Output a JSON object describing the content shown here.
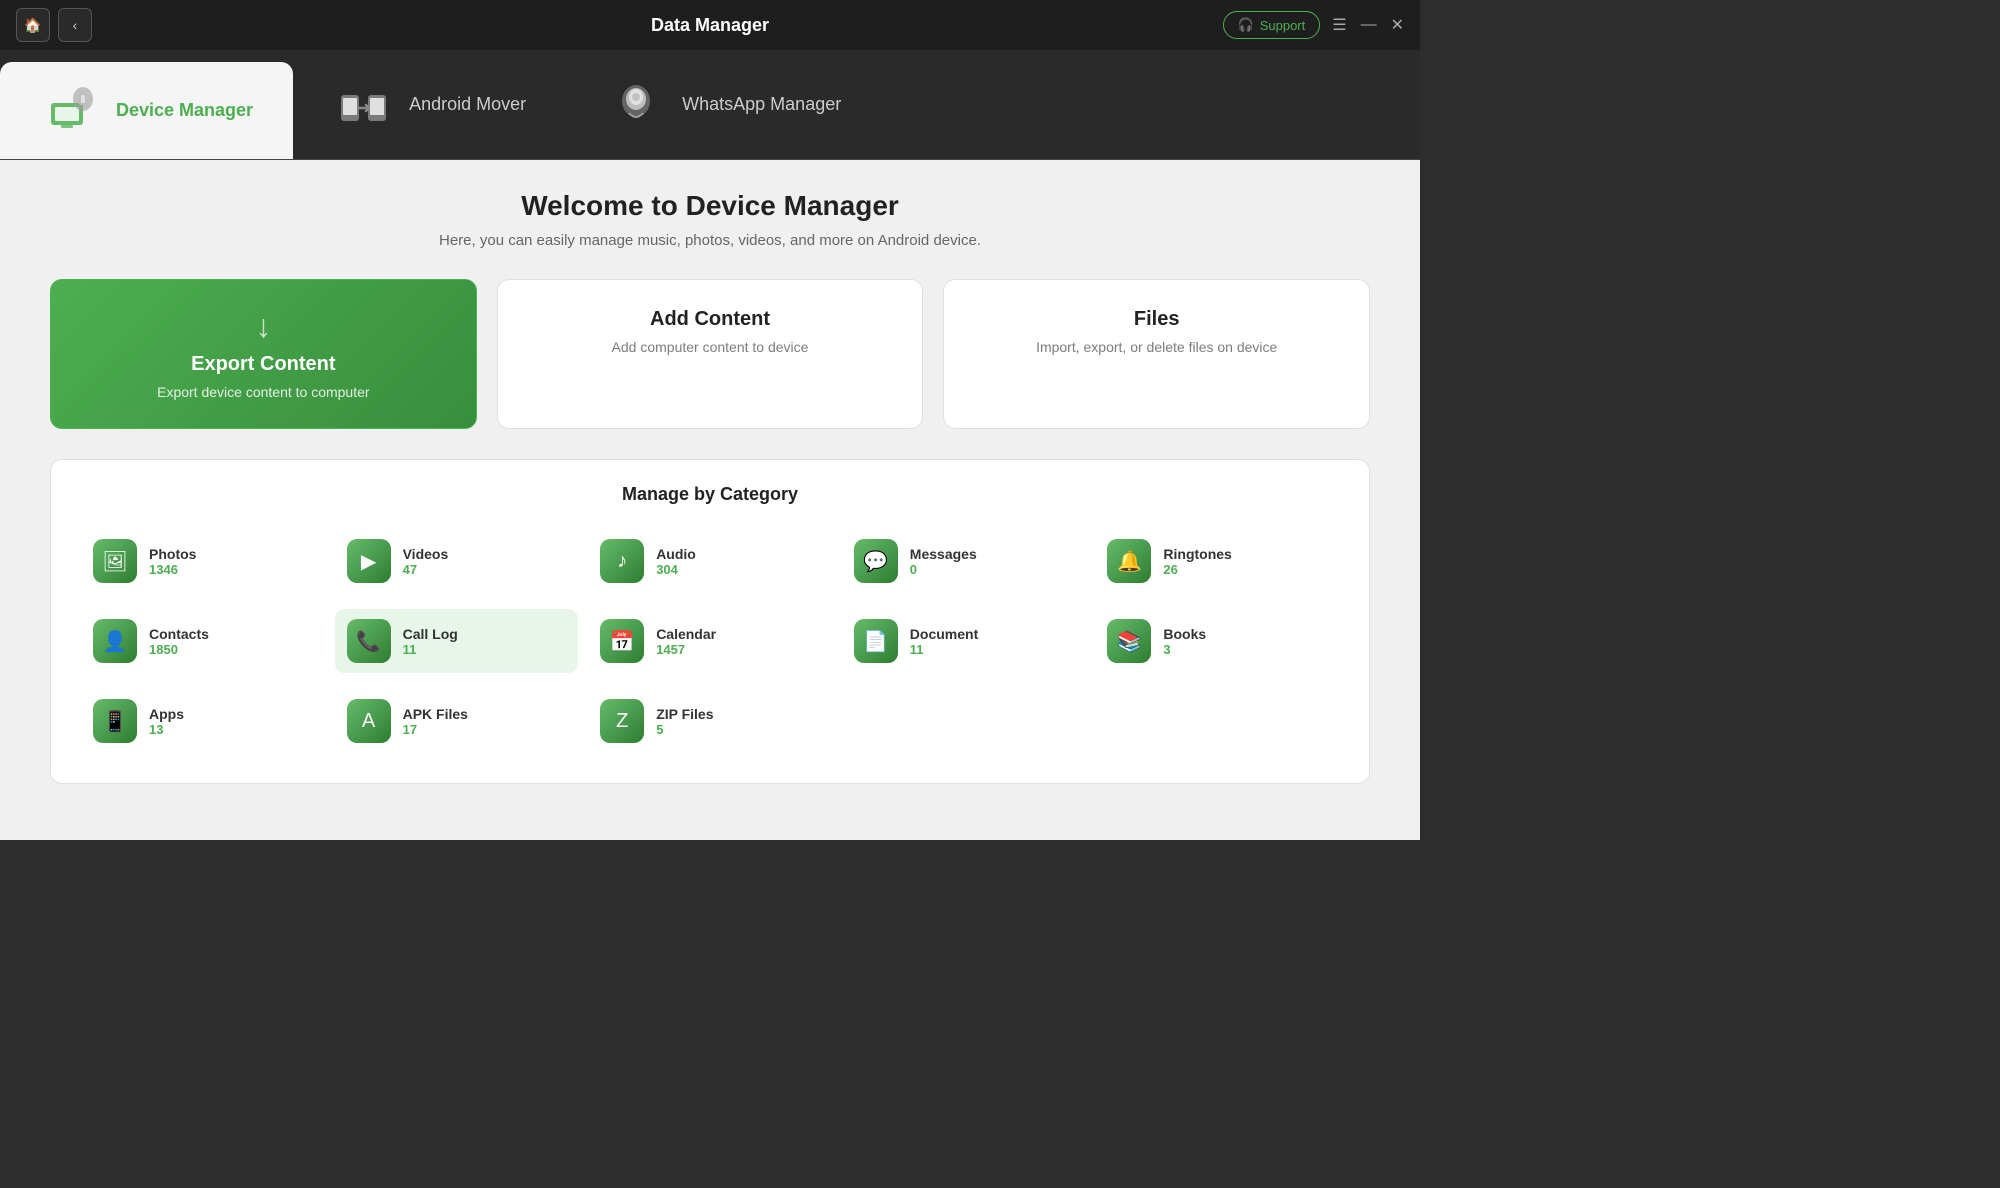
{
  "titlebar": {
    "title": "Data Manager",
    "support_label": "Support",
    "home_icon": "🏠",
    "back_icon": "‹",
    "menu_icon": "☰",
    "minimize_icon": "—",
    "close_icon": "✕"
  },
  "nav": {
    "tabs": [
      {
        "id": "device-manager",
        "label": "Device Manager",
        "active": true
      },
      {
        "id": "android-mover",
        "label": "Android Mover",
        "active": false
      },
      {
        "id": "whatsapp-manager",
        "label": "WhatsApp Manager",
        "active": false
      }
    ]
  },
  "welcome": {
    "title": "Welcome to Device Manager",
    "subtitle": "Here, you can easily manage music, photos, videos, and more on Android device."
  },
  "actions": [
    {
      "id": "export-content",
      "title": "Export Content",
      "desc": "Export device content to computer",
      "active": true
    },
    {
      "id": "add-content",
      "title": "Add Content",
      "desc": "Add computer content to device",
      "active": false
    },
    {
      "id": "files",
      "title": "Files",
      "desc": "Import, export, or delete files on device",
      "active": false
    }
  ],
  "categories": {
    "title": "Manage by Category",
    "items": [
      {
        "id": "photos",
        "name": "Photos",
        "count": "1346",
        "icon": "🖼",
        "highlighted": false
      },
      {
        "id": "videos",
        "name": "Videos",
        "count": "47",
        "icon": "▶",
        "highlighted": false
      },
      {
        "id": "audio",
        "name": "Audio",
        "count": "304",
        "icon": "♪",
        "highlighted": false
      },
      {
        "id": "messages",
        "name": "Messages",
        "count": "0",
        "icon": "💬",
        "highlighted": false
      },
      {
        "id": "ringtones",
        "name": "Ringtones",
        "count": "26",
        "icon": "🔔",
        "highlighted": false
      },
      {
        "id": "contacts",
        "name": "Contacts",
        "count": "1850",
        "icon": "👤",
        "highlighted": false
      },
      {
        "id": "call-log",
        "name": "Call Log",
        "count": "11",
        "icon": "📞",
        "highlighted": true
      },
      {
        "id": "calendar",
        "name": "Calendar",
        "count": "1457",
        "icon": "📅",
        "highlighted": false
      },
      {
        "id": "document",
        "name": "Document",
        "count": "11",
        "icon": "📄",
        "highlighted": false
      },
      {
        "id": "books",
        "name": "Books",
        "count": "3",
        "icon": "📚",
        "highlighted": false
      },
      {
        "id": "apps",
        "name": "Apps",
        "count": "13",
        "icon": "📱",
        "highlighted": false
      },
      {
        "id": "apk-files",
        "name": "APK Files",
        "count": "17",
        "icon": "A",
        "highlighted": false
      },
      {
        "id": "zip-files",
        "name": "ZIP Files",
        "count": "5",
        "icon": "Z",
        "highlighted": false
      }
    ]
  }
}
